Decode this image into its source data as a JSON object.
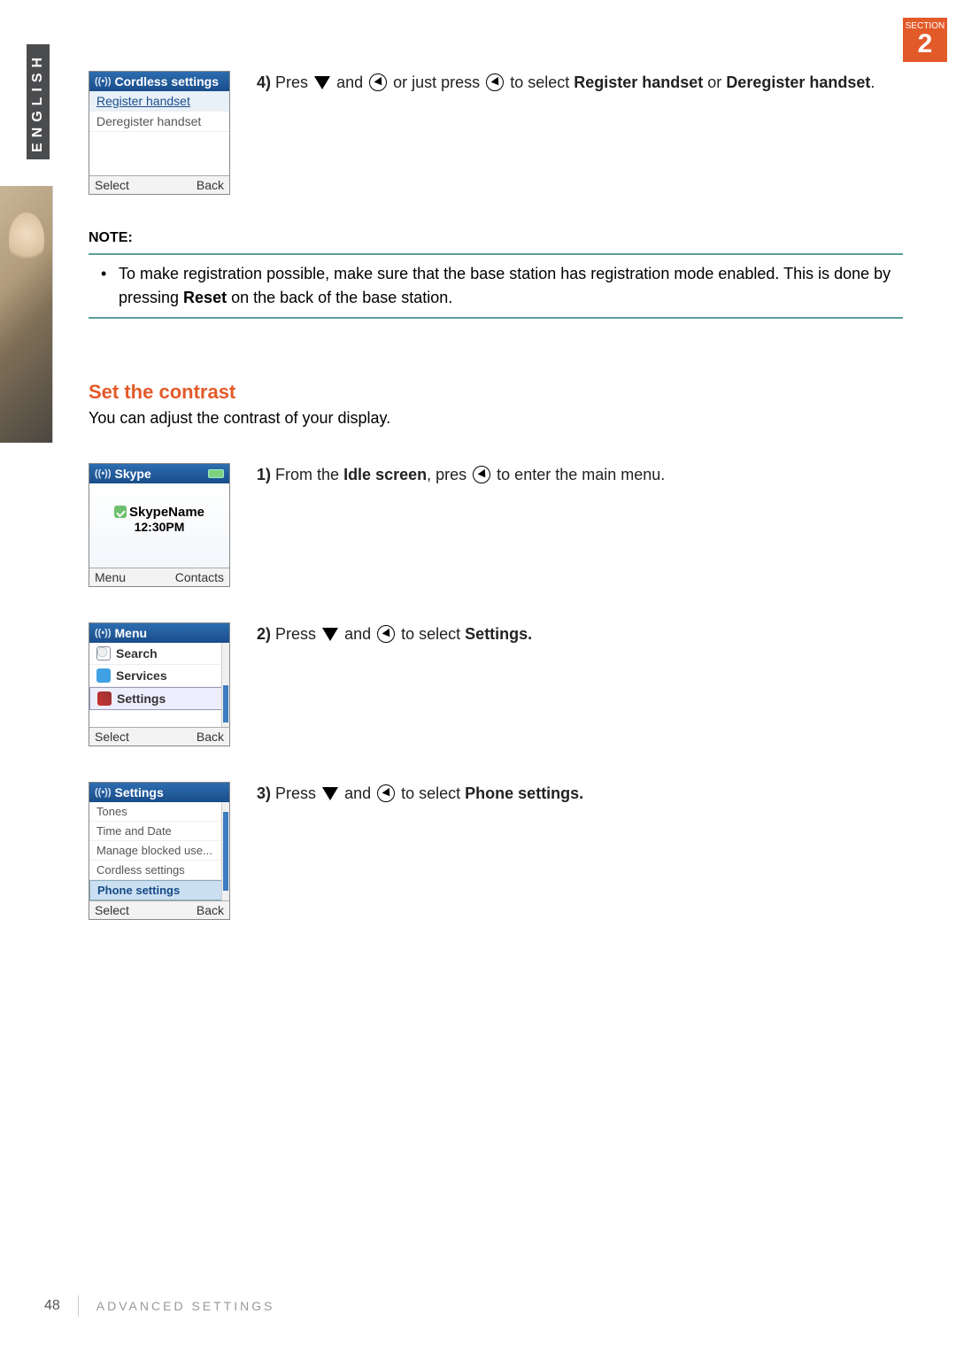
{
  "section": {
    "label": "SECTION",
    "number": "2"
  },
  "language_tab": "ENGLISH",
  "page": {
    "number": "48",
    "footer": "ADVANCED SETTINGS"
  },
  "screen_cordless": {
    "title": "Cordless settings",
    "items": [
      "Register handset",
      "Deregister handset"
    ],
    "soft_left": "Select",
    "soft_right": "Back"
  },
  "step4": {
    "num": "4)",
    "t1": "Pres ",
    "t2": " and ",
    "t3": " or just press ",
    "t4": " to select ",
    "b1": "Register handset",
    "t5": " or ",
    "b2": "Deregister handset",
    "t6": "."
  },
  "note": {
    "label": "NOTE:",
    "t1": "To make registration possible, make sure that the base station has registration mode enabled. This is done by pressing ",
    "b1": "Reset",
    "t2": " on the back of the base station."
  },
  "section_contrast": {
    "heading": "Set the contrast",
    "sub": "You can adjust the contrast of your display."
  },
  "screen_idle": {
    "title": "Skype",
    "name": "SkypeName",
    "time": "12:30PM",
    "soft_left": "Menu",
    "soft_right": "Contacts"
  },
  "step1": {
    "num": "1)",
    "t1": "From the ",
    "b1": "Idle screen",
    "t2": ", pres ",
    "t3": " to enter the main menu."
  },
  "screen_menu": {
    "title": "Menu",
    "items": [
      "Search",
      "Services",
      "Settings"
    ],
    "soft_left": "Select",
    "soft_right": "Back"
  },
  "step2": {
    "num": "2)",
    "t1": "Press ",
    "t2": " and ",
    "t3": " to select ",
    "b1": "Settings."
  },
  "screen_settings": {
    "title": "Settings",
    "items": [
      "Tones",
      "Time and Date",
      "Manage blocked use...",
      "Cordless settings",
      "Phone settings"
    ],
    "soft_left": "Select",
    "soft_right": "Back"
  },
  "step3": {
    "num": "3)",
    "t1": "Press ",
    "t2": " and ",
    "t3": " to select ",
    "b1": "Phone settings."
  }
}
